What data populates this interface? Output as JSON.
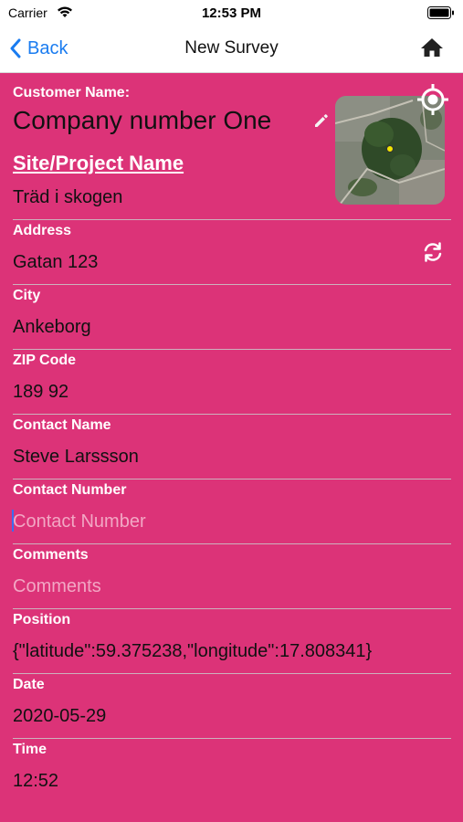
{
  "status_bar": {
    "carrier": "Carrier",
    "time": "12:53 PM"
  },
  "nav": {
    "back_label": "Back",
    "title": "New Survey"
  },
  "form": {
    "customer_label": "Customer Name:",
    "customer_value": "Company number One",
    "site_label": "Site/Project Name",
    "site_value": "Träd i skogen",
    "address_label": "Address",
    "address_value": "Gatan 123",
    "city_label": "City",
    "city_value": "Ankeborg",
    "zip_label": "ZIP Code",
    "zip_value": "189 92",
    "contact_name_label": "Contact Name",
    "contact_name_value": "Steve Larssson",
    "contact_number_label": "Contact Number",
    "contact_number_placeholder": "Contact Number",
    "comments_label": "Comments",
    "comments_placeholder": "Comments",
    "position_label": "Position",
    "position_value": "{\"latitude\":59.375238,\"longitude\":17.808341}",
    "date_label": "Date",
    "date_value": "2020-05-29",
    "time_label": "Time",
    "time_value": "12:52"
  },
  "icons": {
    "back": "chevron-left-icon",
    "home": "home-icon",
    "edit": "pencil-icon",
    "locate": "crosshair-icon",
    "refresh": "refresh-icon"
  },
  "colors": {
    "background": "#dc3378",
    "label": "#ffffff",
    "value": "#111111",
    "placeholder": "#f2a7c4",
    "accent": "#1a7cf0"
  }
}
